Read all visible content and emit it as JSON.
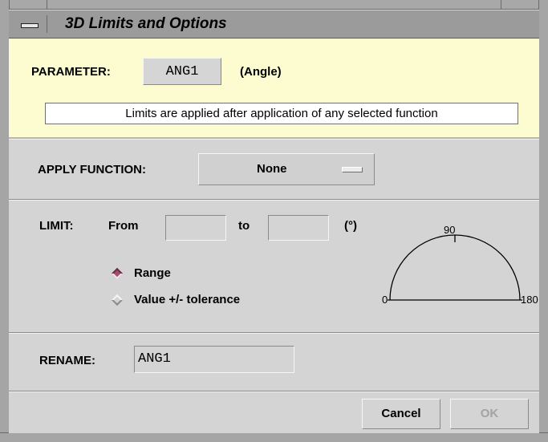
{
  "window": {
    "title": "3D Limits and Options"
  },
  "parameter": {
    "label": "PARAMETER:",
    "value": "ANG1",
    "type": "(Angle)",
    "note": "Limits are applied after application of any selected function"
  },
  "apply_function": {
    "label": "APPLY FUNCTION:",
    "selected": "None"
  },
  "limit": {
    "label": "LIMIT:",
    "from_label": "From",
    "from_value": "",
    "to_label": "to",
    "to_value": "",
    "unit": "(°)",
    "mode_options": [
      {
        "label": "Range",
        "selected": true
      },
      {
        "label": "Value +/- tolerance",
        "selected": false
      }
    ],
    "dial_labels": {
      "min": "0",
      "mid": "90",
      "max": "180"
    }
  },
  "rename": {
    "label": "RENAME:",
    "value": "ANG1"
  },
  "buttons": {
    "cancel": "Cancel",
    "ok": "OK",
    "ok_enabled": false
  },
  "colors": {
    "param_background": "#fdfcd1",
    "panel": "#d4d4d4",
    "radio_selected": "#a0506e"
  }
}
